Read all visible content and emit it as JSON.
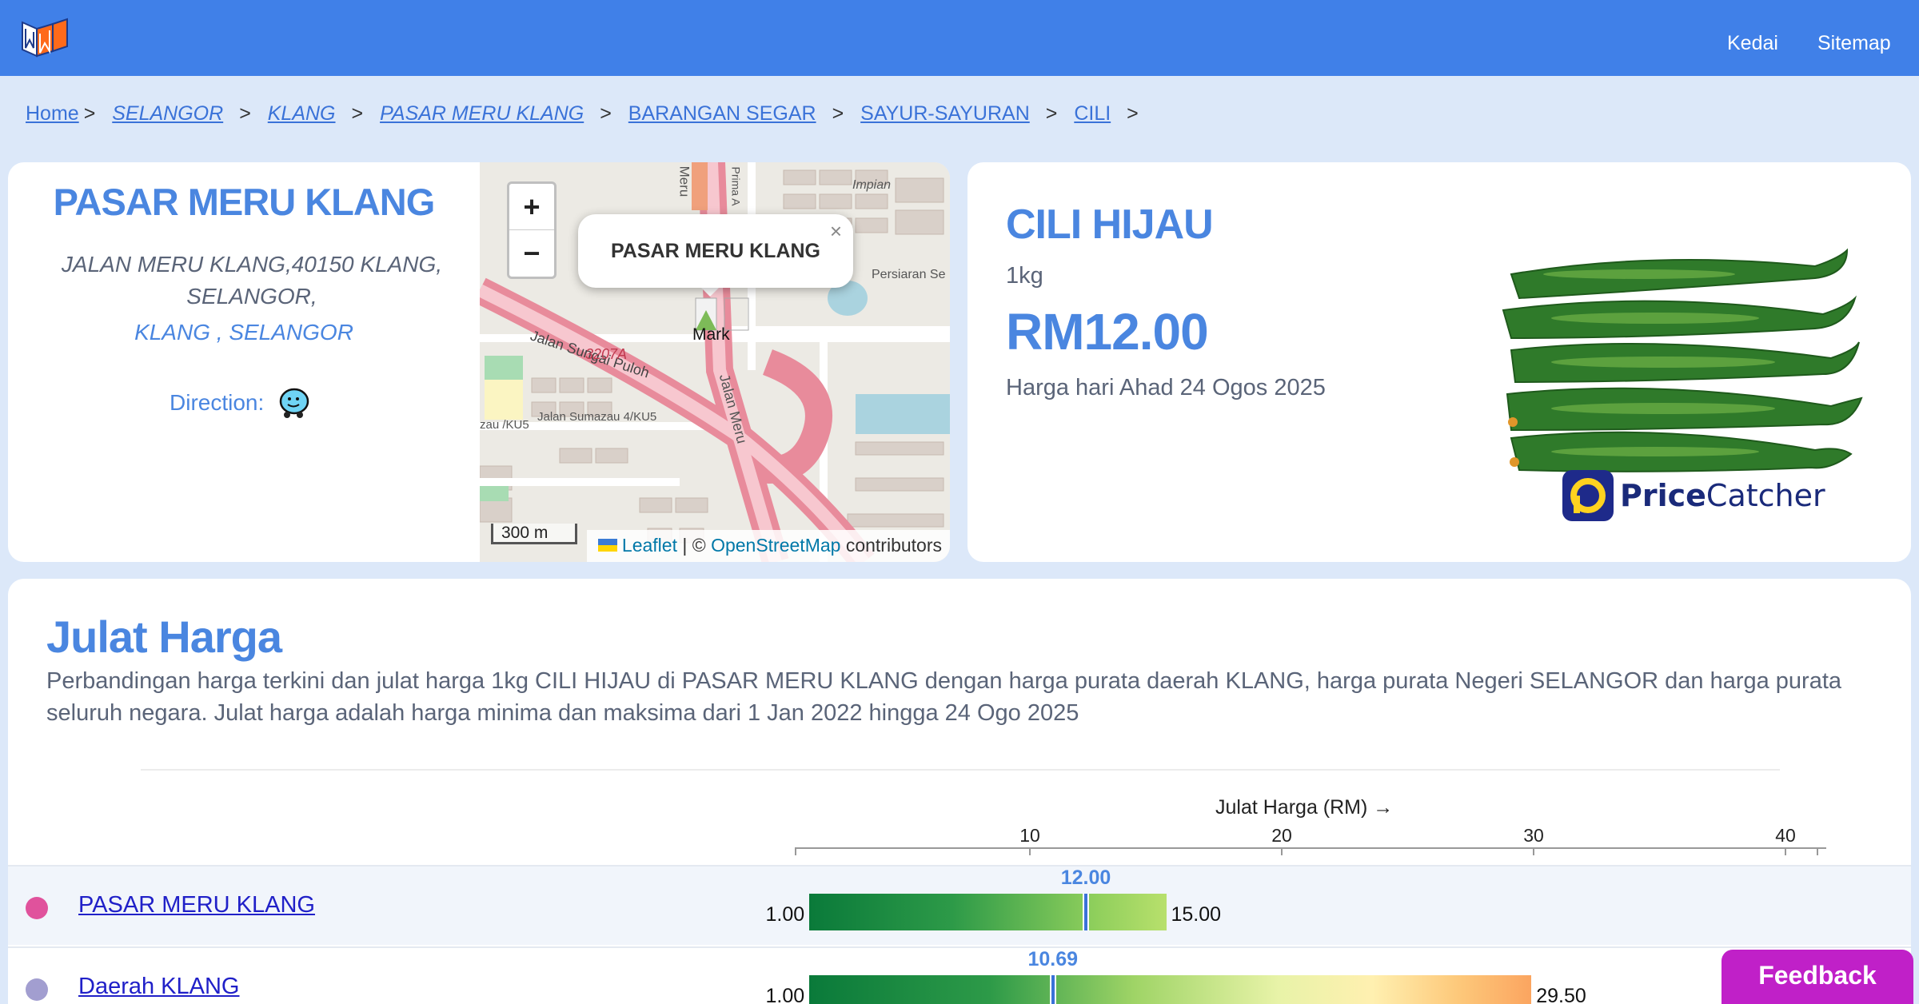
{
  "header": {
    "nav": [
      {
        "label": "Kedai"
      },
      {
        "label": "Sitemap"
      }
    ]
  },
  "breadcrumb": [
    {
      "label": "Home"
    },
    {
      "label": "SELANGOR"
    },
    {
      "label": "KLANG"
    },
    {
      "label": "PASAR MERU KLANG"
    },
    {
      "label": "BARANGAN SEGAR"
    },
    {
      "label": "SAYUR-SAYURAN"
    },
    {
      "label": "CILI"
    }
  ],
  "breadcrumb_sep": ">",
  "market": {
    "name": "PASAR MERU KLANG",
    "address": "JALAN MERU KLANG,40150 KLANG, SELANGOR,",
    "city": "KLANG , SELANGOR",
    "direction_label": "Direction:"
  },
  "map": {
    "zoom_in": "+",
    "zoom_out": "−",
    "popup_label": "PASAR MERU KLANG",
    "popup_close": "×",
    "marker_label": "Mark",
    "scale": "300 m",
    "attribution_leaflet": "Leaflet",
    "attribution_sep": " | © ",
    "attribution_osm": "OpenStreetMap",
    "attribution_tail": " contributors",
    "labels": [
      "Impian",
      "Persiaran Se",
      "Jalan Sungai Puloh",
      "3207A",
      "Jalan Sumazau 4/KU5",
      "zau /KU5",
      "Jalan Meru",
      "Meru",
      "Prima A"
    ]
  },
  "product": {
    "name": "CILI HIJAU",
    "unit": "1kg",
    "price": "RM12.00",
    "date_text": "Harga hari Ahad 24 Ogos 2025",
    "brand_bold": "Price",
    "brand_rest": "Catcher"
  },
  "range": {
    "title": "Julat Harga",
    "description": "Perbandingan harga terkini dan julat harga 1kg CILI HIJAU di PASAR MERU KLANG dengan harga purata daerah KLANG, harga purata Negeri SELANGOR dan harga purata seluruh negara. Julat harga adalah harga minima dan maksima dari 1 Jan 2022 hingga 24 Ogo 2025",
    "axis_title": "Julat Harga (RM) →",
    "ticks": [
      "10",
      "20",
      "30",
      "40"
    ]
  },
  "chart_data": {
    "type": "bar",
    "xlabel": "Julat Harga (RM) →",
    "xlim": [
      0,
      40
    ],
    "rows": [
      {
        "label": "PASAR MERU KLANG",
        "min": 1.0,
        "max": 15.0,
        "current": 12.0,
        "min_label": "1.00",
        "max_label": "15.00",
        "current_label": "12.00",
        "dot_color": "#e0529c"
      },
      {
        "label": "Daerah KLANG",
        "min": 1.0,
        "max": 29.5,
        "current": 10.69,
        "min_label": "1.00",
        "max_label": "29.50",
        "current_label": "10.69",
        "dot_color": "#a29ed0"
      }
    ]
  },
  "feedback": {
    "label": "Feedback"
  },
  "colors": {
    "accent": "#4a86e0",
    "header": "#4080e8",
    "feedback": "#c020c8"
  }
}
